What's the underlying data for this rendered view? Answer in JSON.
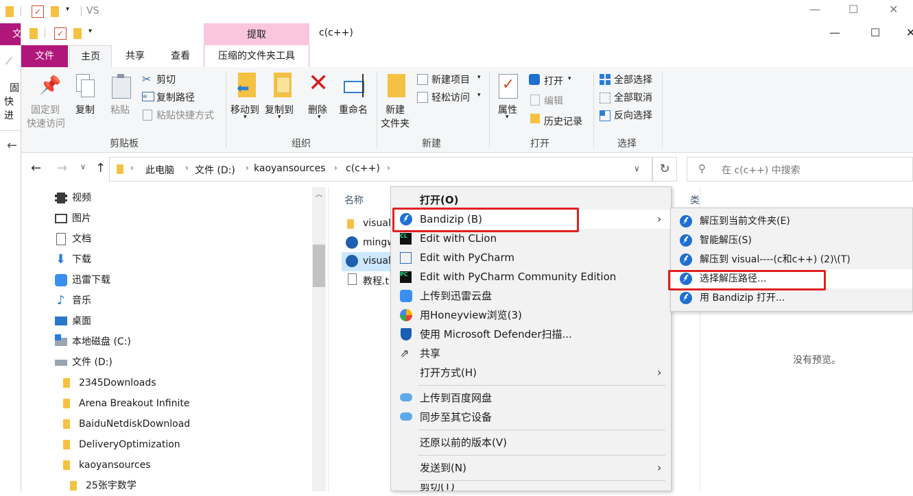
{
  "background_window": {
    "title": "VS",
    "tab_file_partial": "文",
    "left_partial_1": "固",
    "left_partial_2": "快进"
  },
  "window": {
    "title": "c(c++)",
    "contextual_tab_header": "提取",
    "controls": {
      "minimize": "—",
      "maximize": "☐",
      "close": "✕"
    }
  },
  "ribbon_tabs": [
    "文件",
    "主页",
    "共享",
    "查看",
    "压缩的文件夹工具"
  ],
  "ribbon": {
    "clipboard": {
      "pin_label_1": "固定到",
      "pin_label_2": "快速访问",
      "copy": "复制",
      "paste": "粘贴",
      "cut": "剪切",
      "copy_path": "复制路径",
      "paste_shortcut": "粘贴快捷方式",
      "group": "剪贴板"
    },
    "organize": {
      "move_to": "移动到",
      "copy_to": "复制到",
      "delete": "删除",
      "rename": "重命名",
      "group": "组织"
    },
    "new": {
      "new_folder_1": "新建",
      "new_folder_2": "文件夹",
      "new_item": "新建项目",
      "easy_access": "轻松访问",
      "group": "新建"
    },
    "open": {
      "properties": "属性",
      "open": "打开",
      "edit": "编辑",
      "history": "历史记录",
      "group": "打开"
    },
    "select": {
      "select_all": "全部选择",
      "select_none": "全部取消",
      "invert": "反向选择",
      "group": "选择"
    }
  },
  "address_bar": {
    "crumbs": [
      "此电脑",
      "文件 (D:)",
      "kaoyansources",
      "c(c++)"
    ],
    "search_placeholder": "在 c(c++) 中搜索"
  },
  "nav_pane": {
    "items": [
      "视频",
      "图片",
      "文档",
      "下载",
      "迅雷下载",
      "音乐",
      "桌面",
      "本地磁盘 (C:)",
      "文件 (D:)"
    ],
    "folders": [
      "2345Downloads",
      "Arena Breakout Infinite",
      "BaiduNetdiskDownload",
      "DeliveryOptimization",
      "kaoyansources",
      "25张宇数学"
    ]
  },
  "file_list": {
    "column_name": "名称",
    "column_type_partial": "类",
    "items": [
      "visual",
      "mingw",
      "visual",
      "教程.t"
    ]
  },
  "preview_pane": {
    "text": "没有预览。"
  },
  "context_menu": {
    "items": [
      "打开(O)",
      "Bandizip (B)",
      "Edit with CLion",
      "Edit with PyCharm",
      "Edit with PyCharm Community Edition",
      "上传到迅雷云盘",
      "用Honeyview浏览(3)",
      "使用 Microsoft Defender扫描...",
      "共享",
      "打开方式(H)",
      "上传到百度网盘",
      "同步至其它设备",
      "还原以前的版本(V)",
      "发送到(N)",
      "剪切(T)"
    ]
  },
  "submenu": {
    "items": [
      "解压到当前文件夹(E)",
      "智能解压(S)",
      "解压到 visual----(c和c++) (2)\\(T)",
      "选择解压路径...",
      "用 Bandizip 打开..."
    ]
  },
  "colors": {
    "file_tab": "#b0177a",
    "contextual_tab": "#f9c6de",
    "highlight_red": "#e02020",
    "bandizip_blue": "#1f6fd0",
    "folder_yellow": "#f5c143"
  }
}
